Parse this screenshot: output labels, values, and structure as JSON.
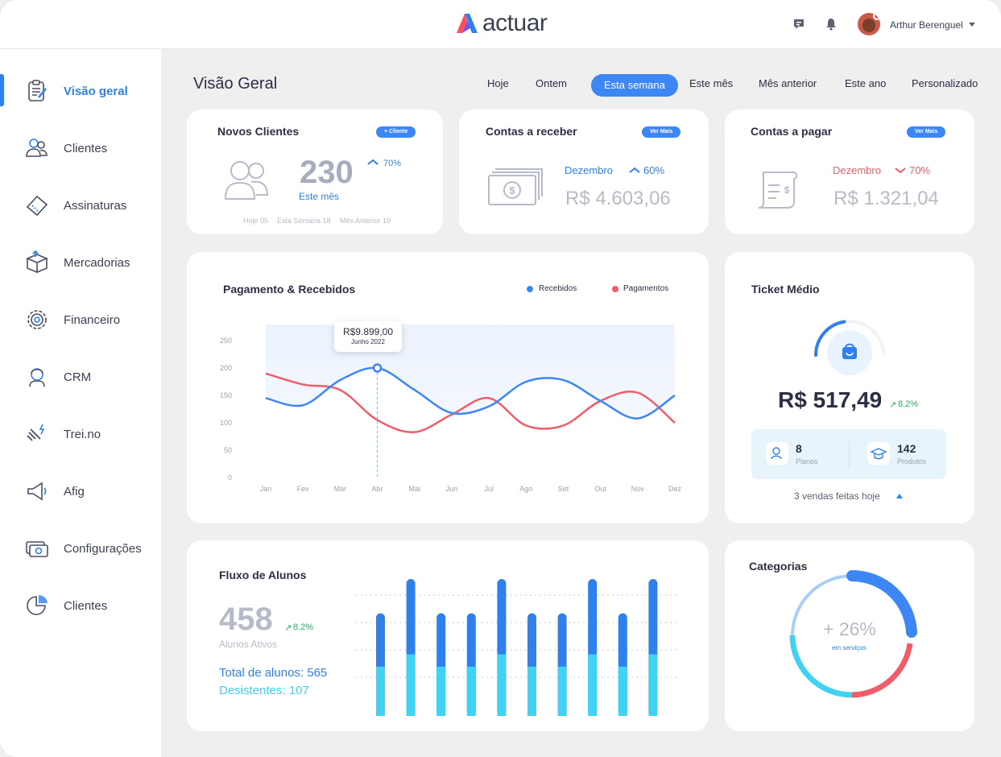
{
  "app": {
    "logo_text": "actuar"
  },
  "header": {
    "user_name": "Arthur Berenguel"
  },
  "sidebar": {
    "items": [
      {
        "label": "Visão geral",
        "icon": "clipboard-icon",
        "active": true
      },
      {
        "label": "Clientes",
        "icon": "users-icon"
      },
      {
        "label": "Assinaturas",
        "icon": "ticket-icon"
      },
      {
        "label": "Mercadorias",
        "icon": "box-icon"
      },
      {
        "label": "Financeiro",
        "icon": "gear-icon"
      },
      {
        "label": "CRM",
        "icon": "headset-icon"
      },
      {
        "label": "Trei.no",
        "icon": "dumbbell-icon"
      },
      {
        "label": "Afig",
        "icon": "megaphone-icon"
      },
      {
        "label": "Configurações",
        "icon": "money-icon"
      },
      {
        "label": "Clientes",
        "icon": "pie-chart-icon"
      }
    ]
  },
  "page": {
    "title": "Visão Geral",
    "tabs": [
      "Hoje",
      "Ontem",
      "Esta semana",
      "Este mês",
      "Mês anterior",
      "Este ano",
      "Personalizado"
    ],
    "active_tab": "Esta semana"
  },
  "novos_clientes": {
    "title": "Novos Clientes",
    "button": "+ Cliente",
    "value": "230",
    "period": "Este mês",
    "change": "70%",
    "footer": [
      "Hoje 05",
      "Esta Semana 18",
      "Mês Anterior 19"
    ]
  },
  "contas_receber": {
    "title": "Contas a receber",
    "button": "Ver Mais",
    "month": "Dezembro",
    "change": "60%",
    "amount": "R$ 4.603,06"
  },
  "contas_pagar": {
    "title": "Contas a pagar",
    "button": "Ver Mais",
    "month": "Dezembro",
    "change": "70%",
    "amount": "R$ 1.321,04"
  },
  "pagamentos": {
    "title": "Pagamento & Recebidos",
    "legend": [
      "Recebidos",
      "Pagamentos"
    ],
    "tooltip_value": "R$9.899,00",
    "tooltip_label": "Junho 2022"
  },
  "chart_data": {
    "type": "line",
    "categories": [
      "Jan",
      "Fev",
      "Mar",
      "Abr",
      "Mai",
      "Jun",
      "Jul",
      "Ago",
      "Set",
      "Out",
      "Nov",
      "Dez"
    ],
    "ylim": [
      0,
      250
    ],
    "yticks": [
      0,
      50,
      100,
      150,
      200,
      250
    ],
    "series": [
      {
        "name": "Recebidos",
        "color": "#3d86f5",
        "values": [
          145,
          132,
          178,
          200,
          160,
          118,
          130,
          175,
          178,
          140,
          108,
          150
        ]
      },
      {
        "name": "Pagamentos",
        "color": "#ef5d6a",
        "values": [
          190,
          170,
          160,
          105,
          83,
          115,
          145,
          95,
          95,
          140,
          155,
          100
        ]
      }
    ],
    "highlight": {
      "category": "Abr",
      "value": 200
    }
  },
  "ticket": {
    "title": "Ticket Médio",
    "value": "R$ 517,49",
    "change": "8.2%",
    "planos_value": "8",
    "planos_label": "Planos",
    "produtos_value": "142",
    "produtos_label": "Produtos",
    "footer": "3 vendas feitas hoje",
    "gauge_fraction": 0.3
  },
  "fluxo": {
    "title": "Fluxo de Alunos",
    "value": "458",
    "change": "8.2%",
    "label": "Alunos Ativos",
    "total": "Total de alunos: 565",
    "desistentes": "Desistentes: 107",
    "bars": [
      {
        "total": 0.75,
        "light": 0.36
      },
      {
        "total": 1.0,
        "light": 0.45
      },
      {
        "total": 0.75,
        "light": 0.36
      },
      {
        "total": 0.75,
        "light": 0.36
      },
      {
        "total": 1.0,
        "light": 0.45
      },
      {
        "total": 0.75,
        "light": 0.36
      },
      {
        "total": 0.75,
        "light": 0.36
      },
      {
        "total": 1.0,
        "light": 0.45
      },
      {
        "total": 0.75,
        "light": 0.36
      },
      {
        "total": 1.0,
        "light": 0.45
      }
    ]
  },
  "categorias": {
    "title": "Categorias",
    "value": "+ 26%",
    "label": "em serviços"
  }
}
